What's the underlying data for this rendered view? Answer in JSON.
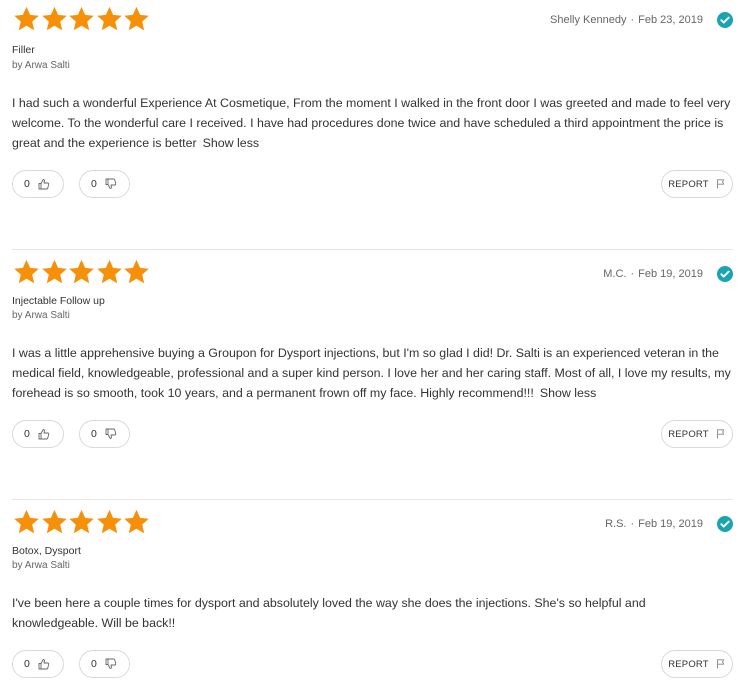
{
  "colors": {
    "star": "#f79009",
    "check": "#1aa3b0",
    "divider": "#e6e6e6"
  },
  "icons": {
    "star": "star-icon",
    "verified": "check-circle-icon",
    "upvote": "thumbs-up-icon",
    "downvote": "thumbs-down-icon",
    "report": "flag-icon"
  },
  "reviews": [
    {
      "rating": 5,
      "author": "Shelly Kennedy",
      "date": "Feb 23, 2019",
      "service": "Filler",
      "provider": "by Arwa Salti",
      "text": "I had such a wonderful Experience At Cosmetique, From the moment I walked in the front door I was greeted and made to feel very welcome. To the wonderful care I received. I have had procedures done twice and have scheduled a third appointment the price is great and the experience is better",
      "show_less": "Show less",
      "upvotes": "0",
      "downvotes": "0",
      "report_label": "REPORT"
    },
    {
      "rating": 5,
      "author": "M.C.",
      "date": "Feb 19, 2019",
      "service": "Injectable Follow up",
      "provider": "by Arwa Salti",
      "text": "I was a little apprehensive buying a Groupon for Dysport injections, but I'm so glad I did! Dr. Salti is an experienced veteran in the medical field, knowledgeable, professional and a super kind person. I love her and her caring staff. Most of all, I love my results, my forehead is so smooth, took 10 years, and a permanent frown off my face. Highly recommend!!!",
      "show_less": "Show less",
      "upvotes": "0",
      "downvotes": "0",
      "report_label": "REPORT"
    },
    {
      "rating": 5,
      "author": "R.S.",
      "date": "Feb 19, 2019",
      "service": "Botox, Dysport",
      "provider": "by Arwa Salti",
      "text": "I've been here a couple times for dysport and absolutely loved the way she does the injections. She's so helpful and knowledgeable. Will be back!!",
      "show_less": "",
      "upvotes": "0",
      "downvotes": "0",
      "report_label": "REPORT"
    }
  ]
}
